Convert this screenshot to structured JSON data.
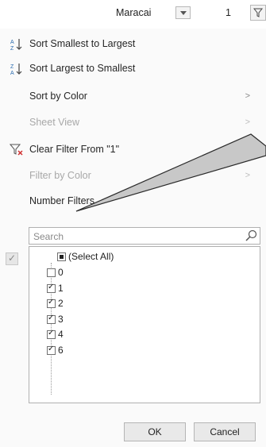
{
  "topbar": {
    "cell_text": "Maracai",
    "cell_number": "1"
  },
  "menu": {
    "sort_asc": "Sort Smallest to Largest",
    "sort_desc": "Sort Largest to Smallest",
    "sort_color": "Sort by Color",
    "sheet_view": "Sheet View",
    "clear_filter": "Clear Filter From \"1\"",
    "filter_color": "Filter by Color",
    "number_filters": "Number Filters"
  },
  "search": {
    "placeholder": "Search"
  },
  "list": {
    "select_all": "(Select All)",
    "items": [
      "0",
      "1",
      "2",
      "3",
      "4",
      "6"
    ]
  },
  "buttons": {
    "ok": "OK",
    "cancel": "Cancel"
  }
}
